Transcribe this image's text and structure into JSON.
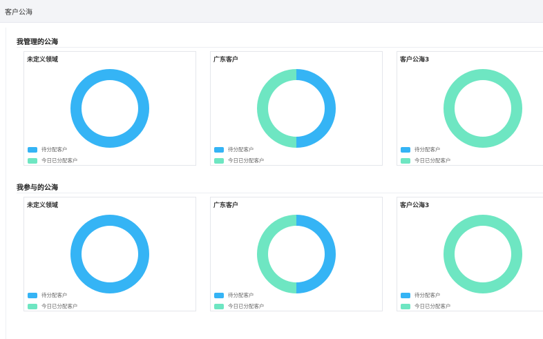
{
  "page": {
    "title": "客户公海"
  },
  "colors": {
    "pending": "#35b4f5",
    "assigned": "#6ee6c2"
  },
  "sections": [
    {
      "title": "我管理的公海"
    },
    {
      "title": "我参与的公海"
    }
  ],
  "legend": {
    "pending": "待分配客户",
    "assigned": "今日已分配客户"
  },
  "chart_data": [
    {
      "type": "pie",
      "title": "未定义领域",
      "categories": [
        "待分配客户",
        "今日已分配客户"
      ],
      "values": [
        1,
        0
      ]
    },
    {
      "type": "pie",
      "title": "广东客户",
      "categories": [
        "待分配客户",
        "今日已分配客户"
      ],
      "values": [
        1,
        1
      ]
    },
    {
      "type": "pie",
      "title": "客户公海3",
      "categories": [
        "待分配客户",
        "今日已分配客户"
      ],
      "values": [
        0,
        1
      ]
    },
    {
      "type": "pie",
      "title": "未定义领域",
      "categories": [
        "待分配客户",
        "今日已分配客户"
      ],
      "values": [
        1,
        0
      ]
    },
    {
      "type": "pie",
      "title": "广东客户",
      "categories": [
        "待分配客户",
        "今日已分配客户"
      ],
      "values": [
        1,
        1
      ]
    },
    {
      "type": "pie",
      "title": "客户公海3",
      "categories": [
        "待分配客户",
        "今日已分配客户"
      ],
      "values": [
        0,
        1
      ]
    }
  ]
}
